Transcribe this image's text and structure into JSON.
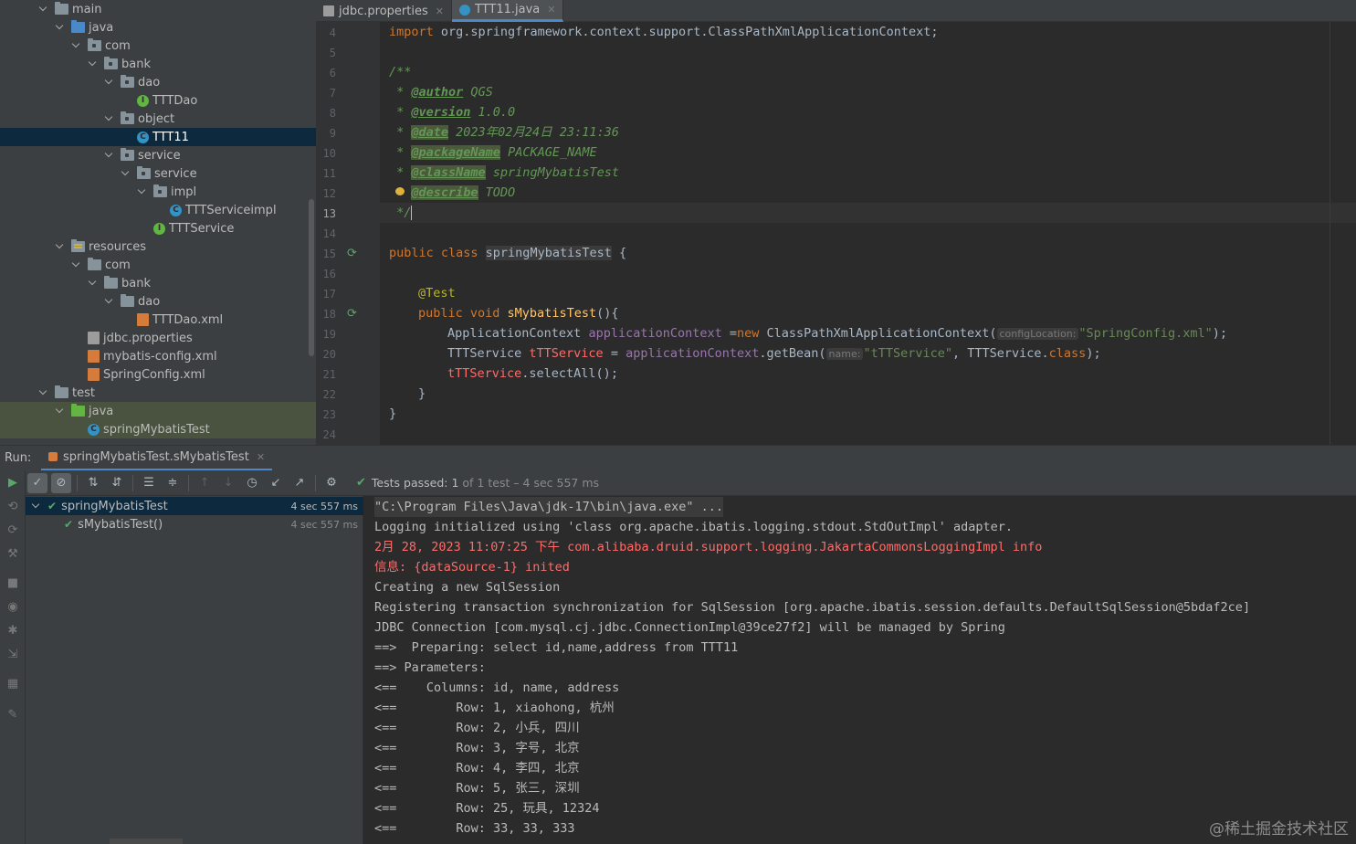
{
  "project_tree": [
    {
      "label": "main",
      "icon": "folder",
      "indent": 60
    },
    {
      "label": "java",
      "icon": "src-folder",
      "indent": 78
    },
    {
      "label": "com",
      "icon": "package",
      "indent": 96
    },
    {
      "label": "bank",
      "icon": "package",
      "indent": 114
    },
    {
      "label": "dao",
      "icon": "package",
      "indent": 132
    },
    {
      "label": "TTTDao",
      "icon": "interface",
      "indent": 150
    },
    {
      "label": "object",
      "icon": "package",
      "indent": 132
    },
    {
      "label": "TTT11",
      "icon": "class",
      "indent": 150
    },
    {
      "label": "service",
      "icon": "package",
      "indent": 132
    },
    {
      "label": "service",
      "icon": "package",
      "indent": 150
    },
    {
      "label": "impl",
      "icon": "package",
      "indent": 168
    },
    {
      "label": "TTTServiceimpl",
      "icon": "class",
      "indent": 186
    },
    {
      "label": "TTTService",
      "icon": "interface",
      "indent": 168
    },
    {
      "label": "resources",
      "icon": "res-folder",
      "indent": 78
    },
    {
      "label": "com",
      "icon": "folder",
      "indent": 96
    },
    {
      "label": "bank",
      "icon": "folder",
      "indent": 114
    },
    {
      "label": "dao",
      "icon": "folder",
      "indent": 132
    },
    {
      "label": "TTTDao.xml",
      "icon": "xml",
      "indent": 150
    },
    {
      "label": "jdbc.properties",
      "icon": "props",
      "indent": 96
    },
    {
      "label": "mybatis-config.xml",
      "icon": "xml",
      "indent": 96
    },
    {
      "label": "SpringConfig.xml",
      "icon": "xml",
      "indent": 96
    },
    {
      "label": "test",
      "icon": "folder",
      "indent": 60
    },
    {
      "label": "java",
      "icon": "test-folder",
      "indent": 78
    },
    {
      "label": "springMybatisTest",
      "icon": "class",
      "indent": 96
    }
  ],
  "tabs": [
    {
      "label": "jdbc.properties",
      "icon": "props"
    },
    {
      "label": "TTT11.java",
      "icon": "class"
    }
  ],
  "line_numbers": [
    "4",
    "5",
    "6",
    "7",
    "8",
    "9",
    "10",
    "11",
    "12",
    "13",
    "14",
    "15",
    "16",
    "17",
    "18",
    "19",
    "20",
    "21",
    "22",
    "23",
    "24"
  ],
  "code": {
    "l4_kw": "import",
    "l4_rest": " org.springframework.context.support.ClassPathXmlApplicationContext;",
    "l6": "/**",
    "l7_star": " * ",
    "l7_tag": "@author",
    "l7_val": " QGS",
    "l8_tag": "@version",
    "l8_val": " 1.0.0",
    "l9_tag": "@date",
    "l9_val": " 2023年02月24日 23:11:36",
    "l10_tag": "@packageName",
    "l10_val": " PACKAGE_NAME",
    "l11_tag": "@className",
    "l11_val": " springMybatisTest",
    "l12_tag": "@describe",
    "l12_val": " TODO",
    "l13": " */",
    "l15_kw": "public class ",
    "l15_name": "springMybatisTest",
    "l15_end": " {",
    "l17": "@Test",
    "l18_kw": "public void ",
    "l18_fn": "sMybatisTest",
    "l18_end": "(){",
    "l19_a": "ApplicationContext ",
    "l19_var": "applicationContext",
    "l19_b": " =",
    "l19_new": "new",
    "l19_c": " ClassPathXmlApplicationContext(",
    "l19_hint": "configLocation:",
    "l19_str": "\"SpringConfig.xml\"",
    "l19_end": ");",
    "l20_a": "TTTService ",
    "l20_var": "tTTService",
    "l20_b": " = ",
    "l20_var2": "applicationContext",
    "l20_c": ".getBean(",
    "l20_hint": "name:",
    "l20_str": "\"tTTService\"",
    "l20_d": ", TTTService.",
    "l20_cls": "class",
    "l20_end": ");",
    "l21_var": "tTTService",
    "l21_end": ".selectAll();",
    "l22": "}",
    "l23": "}"
  },
  "run": {
    "label": "Run:",
    "tab": "springMybatisTest.sMybatisTest",
    "status_prefix": "Tests passed:",
    "status_count": "1",
    "status_rest": "of 1 test – 4 sec 557 ms"
  },
  "test_tree": [
    {
      "label": "springMybatisTest",
      "time": "4 sec 557 ms"
    },
    {
      "label": "sMybatisTest()",
      "time": "4 sec 557 ms"
    }
  ],
  "console": [
    {
      "text": "\"C:\\Program Files\\Java\\jdk-17\\bin\\java.exe\" ...",
      "style": "cmd"
    },
    {
      "text": "Logging initialized using 'class org.apache.ibatis.logging.stdout.StdOutImpl' adapter.",
      "style": "normal"
    },
    {
      "text": "2月 28, 2023 11:07:25 下午 com.alibaba.druid.support.logging.JakartaCommonsLoggingImpl info",
      "style": "red"
    },
    {
      "text": "信息: {dataSource-1} inited",
      "style": "red"
    },
    {
      "text": "Creating a new SqlSession",
      "style": "normal"
    },
    {
      "text": "Registering transaction synchronization for SqlSession [org.apache.ibatis.session.defaults.DefaultSqlSession@5bdaf2ce]",
      "style": "normal"
    },
    {
      "text": "JDBC Connection [com.mysql.cj.jdbc.ConnectionImpl@39ce27f2] will be managed by Spring",
      "style": "normal"
    },
    {
      "text": "==>  Preparing: select id,name,address from TTT11",
      "style": "normal"
    },
    {
      "text": "==> Parameters: ",
      "style": "normal"
    },
    {
      "text": "<==    Columns: id, name, address",
      "style": "normal"
    },
    {
      "text": "<==        Row: 1, xiaohong, 杭州",
      "style": "normal"
    },
    {
      "text": "<==        Row: 2, 小兵, 四川",
      "style": "normal"
    },
    {
      "text": "<==        Row: 3, 字号, 北京",
      "style": "normal"
    },
    {
      "text": "<==        Row: 4, 李四, 北京",
      "style": "normal"
    },
    {
      "text": "<==        Row: 5, 张三, 深圳",
      "style": "normal"
    },
    {
      "text": "<==        Row: 25, 玩具, 12324",
      "style": "normal"
    },
    {
      "text": "<==        Row: 33, 33, 333",
      "style": "normal"
    }
  ],
  "watermark": "@稀土掘金技术社区"
}
